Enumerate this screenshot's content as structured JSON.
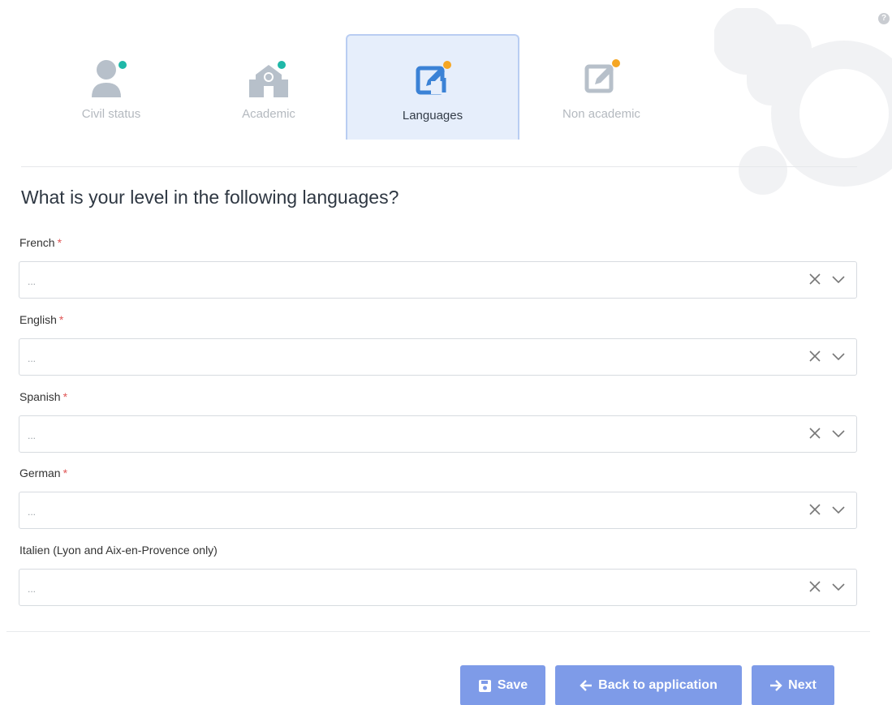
{
  "steps": [
    {
      "label": "Civil status",
      "icon": "user-icon",
      "active": false
    },
    {
      "label": "Academic",
      "icon": "school-icon",
      "active": false
    },
    {
      "label": "Languages",
      "icon": "edit-icon",
      "active": true
    },
    {
      "label": "Non academic",
      "icon": "edit-icon",
      "active": false
    }
  ],
  "question": "What is your level in the following languages?",
  "fields": [
    {
      "label": "French",
      "required": "*",
      "value": "..."
    },
    {
      "label": "English",
      "required": "*",
      "value": "..."
    },
    {
      "label": "Spanish",
      "required": "*",
      "value": "..."
    },
    {
      "label": "German",
      "required": "*",
      "value": "..."
    },
    {
      "label": "Italien (Lyon and Aix-en-Provence only)",
      "required": "",
      "value": "..."
    }
  ],
  "buttons": {
    "save": "Save",
    "back": "Back to application",
    "next": "Next"
  },
  "colors": {
    "accent": "#7e9be8",
    "teal_dot": "#1fb8a8",
    "orange_dot": "#f5a623",
    "active_step_bg": "#e6eefb",
    "required": "#e05656"
  }
}
